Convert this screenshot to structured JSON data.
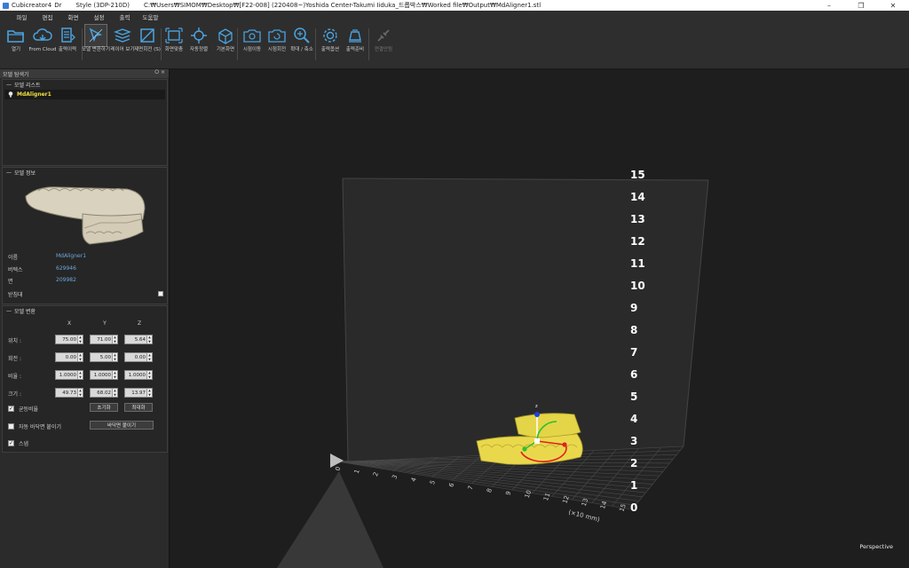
{
  "window": {
    "app": "Cubicreator4",
    "dr": "Dr",
    "style": "Style (3DP-210D)",
    "path": "C:₩Users₩SIMOM₩Desktop₩[F22-008] (220408~)Yoshida Center-Takumi Iiduka_드롭박스₩Worked file₩Output₩MdAligner1.stl",
    "min": "–",
    "max": "❐",
    "close": "✕"
  },
  "menu": [
    "파일",
    "편집",
    "화면",
    "설정",
    "출력",
    "도움말"
  ],
  "toolbar": [
    {
      "label": "열기",
      "icon": "open-folder-icon"
    },
    {
      "label": "From Cloud",
      "icon": "cloud-download-icon"
    },
    {
      "label": "출력이력",
      "icon": "print-history-icon"
    },
    {
      "label": "모델 변환하기",
      "icon": "model-transform-icon"
    },
    {
      "label": "레이어 보기",
      "icon": "layer-view-icon"
    },
    {
      "label": "제면회전 (S)",
      "icon": "face-rotate-icon"
    },
    {
      "label": "화면맞춤",
      "icon": "fit-screen-icon"
    },
    {
      "label": "자동정렬",
      "icon": "auto-arrange-icon"
    },
    {
      "label": "기본화면",
      "icon": "default-view-icon"
    },
    {
      "label": "시점이동",
      "icon": "view-move-icon"
    },
    {
      "label": "시점회전",
      "icon": "view-rotate-icon"
    },
    {
      "label": "확대 / 축소",
      "icon": "zoom-icon"
    },
    {
      "label": "출력옵션",
      "icon": "print-options-icon"
    },
    {
      "label": "출력준비",
      "icon": "print-prepare-icon"
    },
    {
      "label": "연결안됨",
      "icon": "disconnected-icon"
    }
  ],
  "panel": {
    "title": "모델 탐색기",
    "pin": "⭘ ×",
    "list_title": "모델 리스트",
    "list_item": "MdAligner1",
    "info_title": "모델 정보",
    "name_label": "이름",
    "name_value": "MdAligner1",
    "vertex_label": "버텍스",
    "vertex_value": "629946",
    "face_label": "면",
    "face_value": "209982",
    "support_label": "받침대",
    "transform_title": "모델 변환",
    "axes": [
      "X",
      "Y",
      "Z"
    ],
    "rows": [
      {
        "label": "위치 :",
        "values": [
          "75.00",
          "71.00",
          "5.64"
        ]
      },
      {
        "label": "회전 :",
        "values": [
          "0.00",
          "5.00",
          "0.00"
        ]
      },
      {
        "label": "비율 :",
        "values": [
          "1.0000",
          "1.0000",
          "1.0000"
        ]
      },
      {
        "label": "크기 :",
        "values": [
          "49.73",
          "68.02",
          "13.97"
        ]
      }
    ],
    "uniform_label": "균등비율",
    "reset_label": "초기화",
    "maximize_label": "최대화",
    "auto_floor_label": "자동 바닥면 붙이기",
    "floor_button": "바닥면 붙이기",
    "snap_label": "스냅",
    "uniform_checked": true,
    "auto_floor_checked": false,
    "snap_checked": true,
    "support_checked": false
  },
  "viewport": {
    "z_ticks": [
      "15",
      "14",
      "13",
      "12",
      "11",
      "10",
      "9",
      "8",
      "7",
      "6",
      "5",
      "4",
      "3",
      "2",
      "1",
      "0"
    ],
    "x_ticks": [
      "0",
      "1",
      "2",
      "3",
      "4",
      "5",
      "6",
      "7",
      "8",
      "9",
      "10",
      "11",
      "12",
      "13",
      "14",
      "15"
    ],
    "x_unit": "(×10 mm)",
    "projection": "Perspective",
    "model_color": "#e0d24a",
    "grid_color": "#4a4a4a"
  }
}
